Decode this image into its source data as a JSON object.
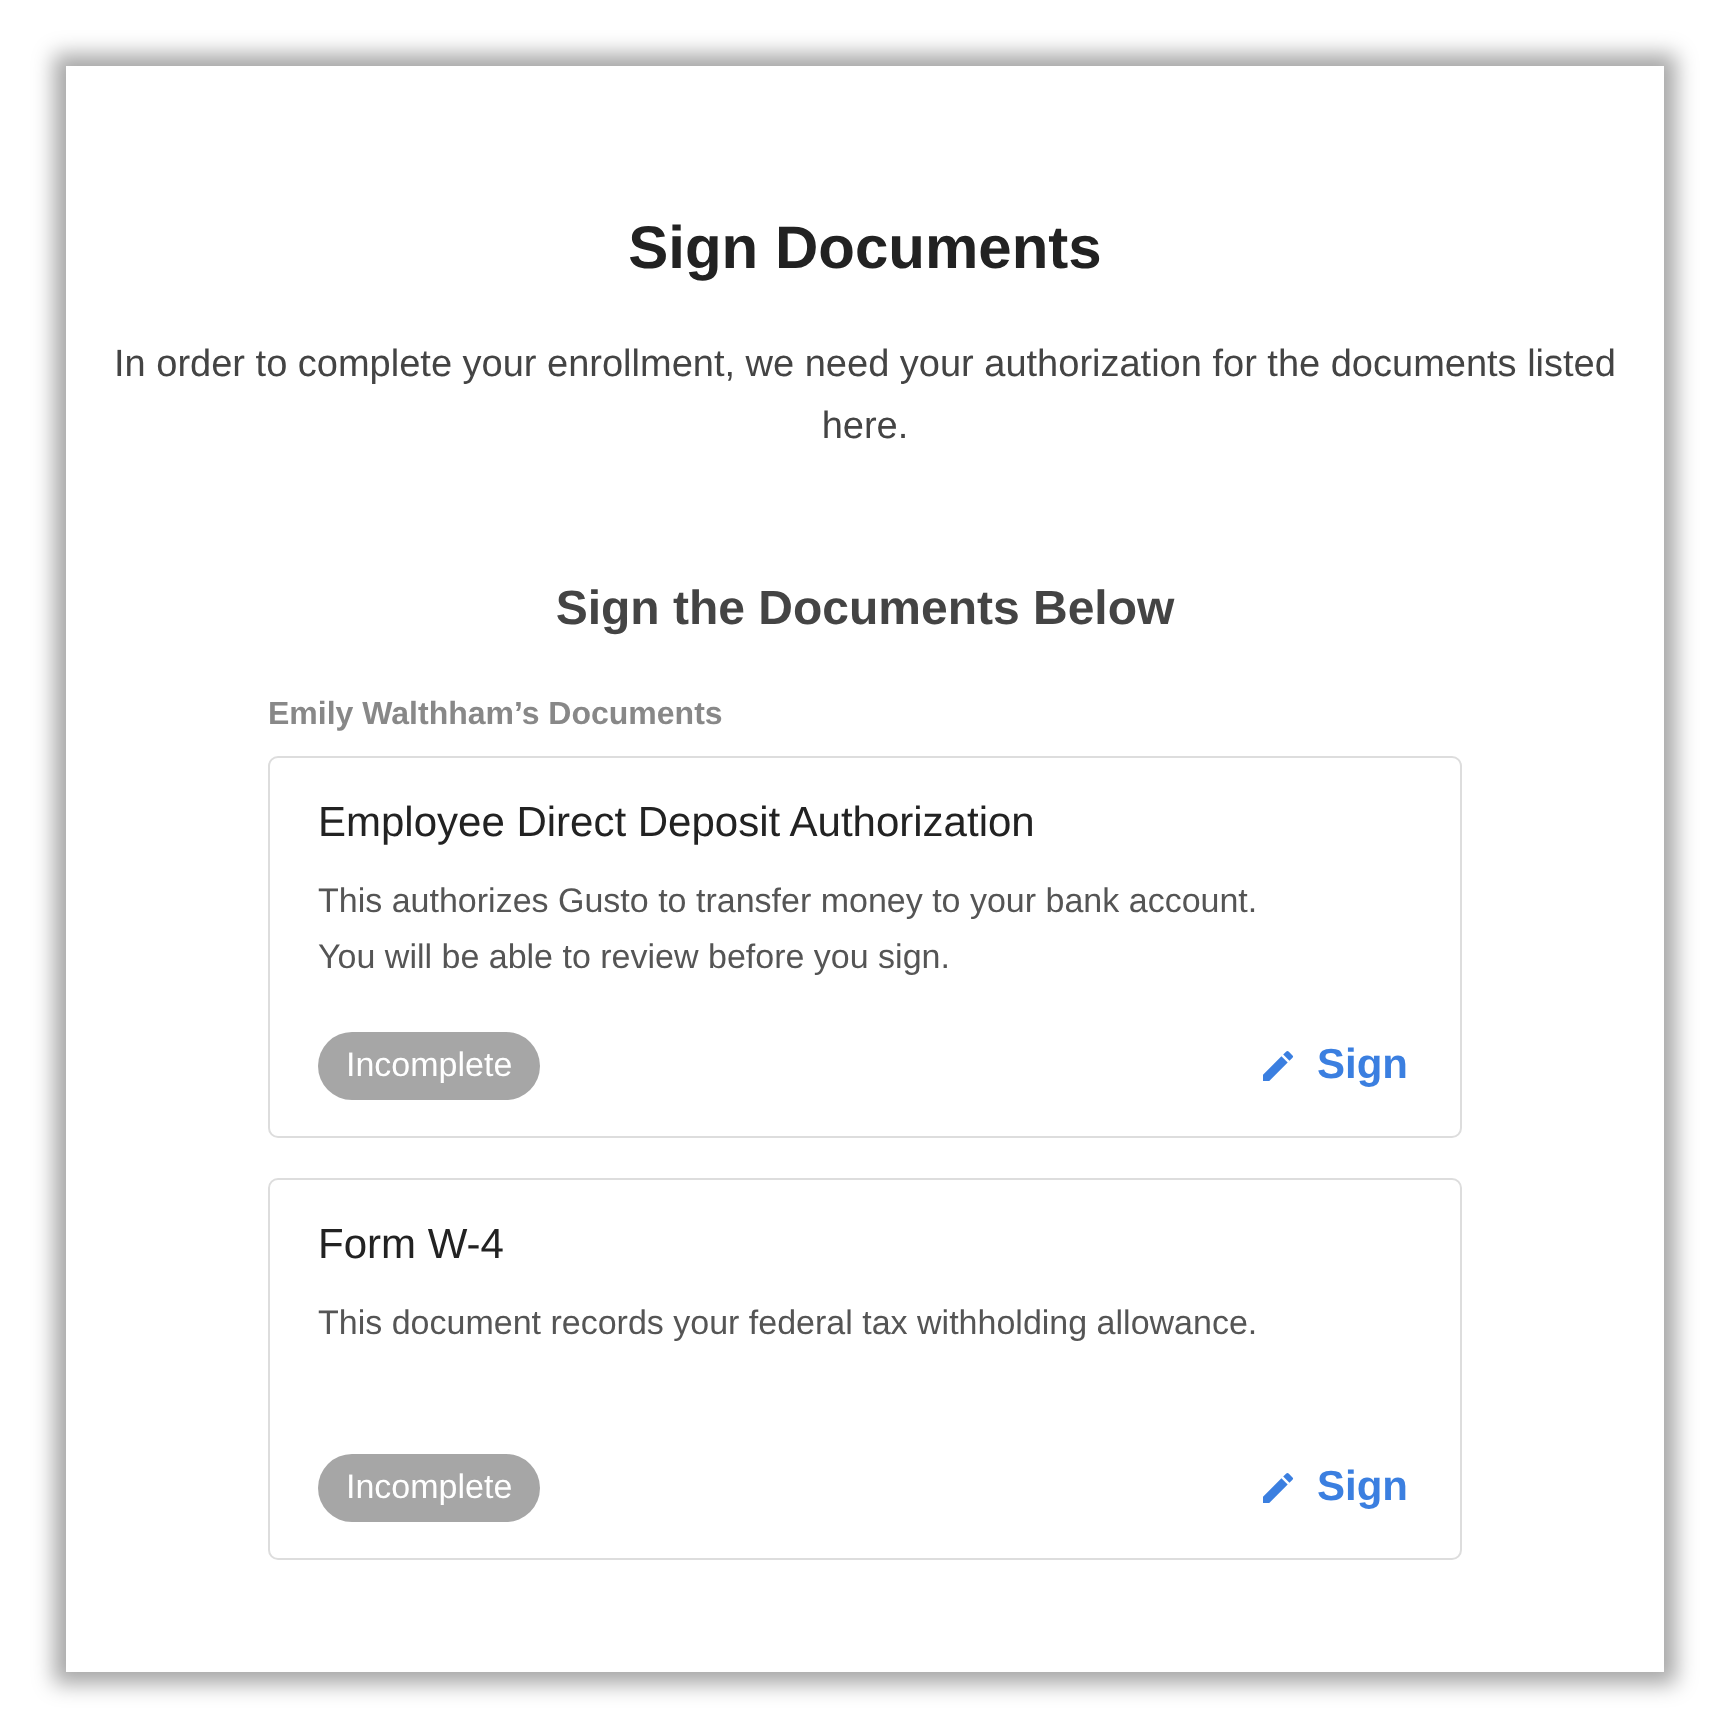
{
  "title": "Sign Documents",
  "intro": "In order to complete your enrollment, we need your authorization for the documents listed here.",
  "subheading": "Sign the Documents Below",
  "section_label": "Emily Walthham’s Documents",
  "documents": [
    {
      "title": "Employee Direct Deposit Authorization",
      "description": "This authorizes Gusto to transfer money to your bank account. You will be able to review before you sign.",
      "status": {
        "label": "Incomplete",
        "complete": false
      },
      "action": "Sign"
    },
    {
      "title": "Form W-4",
      "description": "This document records your federal tax withholding allowance.",
      "status": {
        "label": "Incomplete",
        "complete": false
      },
      "action": "Sign"
    }
  ]
}
